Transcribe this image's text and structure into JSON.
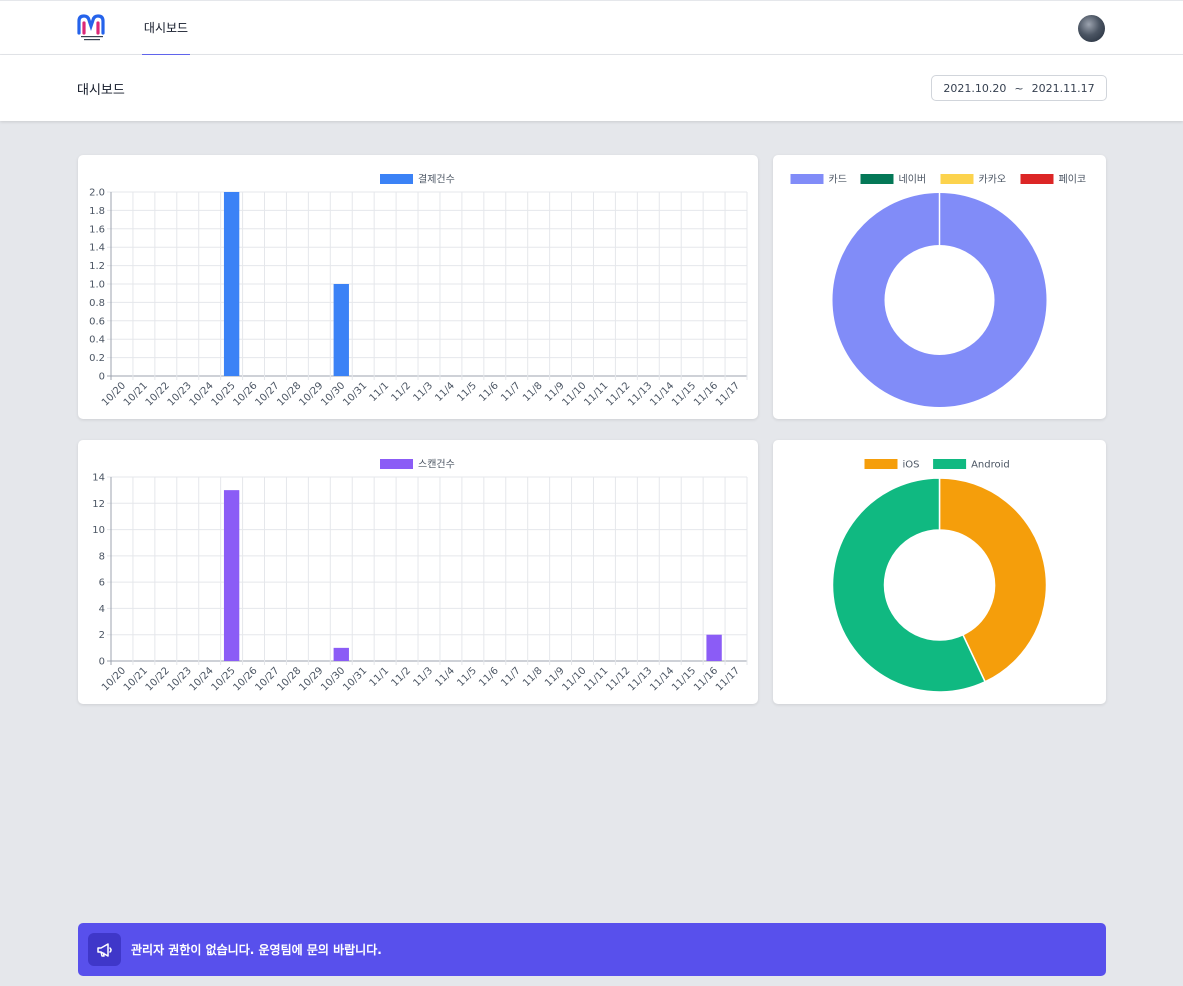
{
  "nav": {
    "tab_label": "대시보드",
    "logo_icon": "museum-logo-icon",
    "avatar_icon": "user-avatar-icon"
  },
  "header": {
    "title": "대시보드",
    "date_start": "2021.10.20",
    "date_separator": "~",
    "date_end": "2021.11.17"
  },
  "notice": {
    "icon": "megaphone-icon",
    "text": "관리자 권한이 없습니다. 운영팀에 문의 바랍니다."
  },
  "colors": {
    "accent": "#5850ec",
    "payment_bar": "#3b82f6",
    "scan_bar": "#8b5cf6"
  },
  "chart_data": [
    {
      "type": "bar",
      "categories": [
        "10/20",
        "10/21",
        "10/22",
        "10/23",
        "10/24",
        "10/25",
        "10/26",
        "10/27",
        "10/28",
        "10/29",
        "10/30",
        "10/31",
        "11/1",
        "11/2",
        "11/3",
        "11/4",
        "11/5",
        "11/6",
        "11/7",
        "11/8",
        "11/9",
        "11/10",
        "11/11",
        "11/12",
        "11/13",
        "11/14",
        "11/15",
        "11/16",
        "11/17"
      ],
      "series": [
        {
          "name": "결제건수",
          "color": "#3b82f6",
          "values": [
            0,
            0,
            0,
            0,
            0,
            2,
            0,
            0,
            0,
            0,
            1,
            0,
            0,
            0,
            0,
            0,
            0,
            0,
            0,
            0,
            0,
            0,
            0,
            0,
            0,
            0,
            0,
            0,
            0
          ]
        }
      ],
      "ylim": [
        0,
        2
      ],
      "yticks": [
        "0",
        "0.2",
        "0.4",
        "0.6",
        "0.8",
        "1.0",
        "1.2",
        "1.4",
        "1.6",
        "1.8",
        "2.0"
      ],
      "grid": true,
      "legend": "top"
    },
    {
      "type": "pie",
      "donut": true,
      "labels": [
        "카드",
        "네이버",
        "카카오",
        "페이코"
      ],
      "values": [
        1,
        0,
        0,
        0
      ],
      "colors": [
        "#818cf8",
        "#047857",
        "#fcd34d",
        "#dc2626"
      ],
      "legend": "top"
    },
    {
      "type": "bar",
      "categories": [
        "10/20",
        "10/21",
        "10/22",
        "10/23",
        "10/24",
        "10/25",
        "10/26",
        "10/27",
        "10/28",
        "10/29",
        "10/30",
        "10/31",
        "11/1",
        "11/2",
        "11/3",
        "11/4",
        "11/5",
        "11/6",
        "11/7",
        "11/8",
        "11/9",
        "11/10",
        "11/11",
        "11/12",
        "11/13",
        "11/14",
        "11/15",
        "11/16",
        "11/17"
      ],
      "series": [
        {
          "name": "스캔건수",
          "color": "#8b5cf6",
          "values": [
            0,
            0,
            0,
            0,
            0,
            13,
            0,
            0,
            0,
            0,
            1,
            0,
            0,
            0,
            0,
            0,
            0,
            0,
            0,
            0,
            0,
            0,
            0,
            0,
            0,
            0,
            0,
            2,
            0
          ]
        }
      ],
      "ylim": [
        0,
        14
      ],
      "yticks": [
        "0",
        "2",
        "4",
        "6",
        "8",
        "10",
        "12",
        "14"
      ],
      "grid": true,
      "legend": "top"
    },
    {
      "type": "pie",
      "donut": true,
      "labels": [
        "iOS",
        "Android"
      ],
      "values": [
        43,
        57
      ],
      "colors": [
        "#f59e0b",
        "#10b981"
      ],
      "legend": "top"
    }
  ]
}
